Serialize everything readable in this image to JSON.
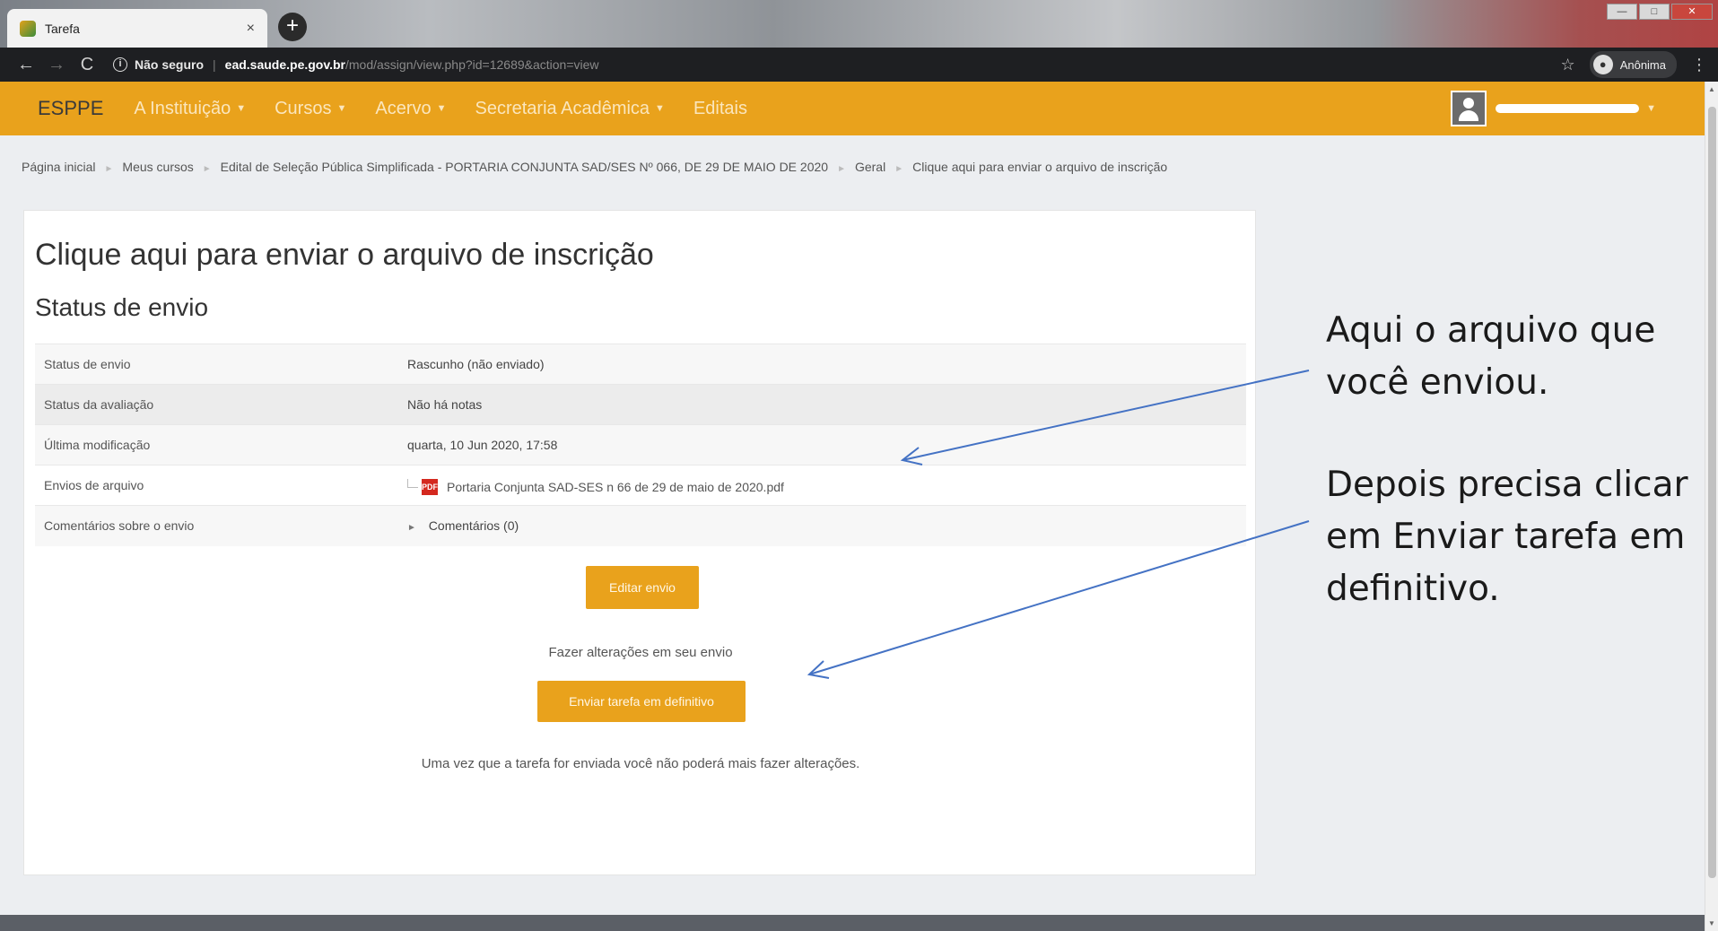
{
  "browser": {
    "tab_title": "Tarefa",
    "tab_close": "×",
    "new_tab": "+",
    "back": "←",
    "forward": "→",
    "reload": "C",
    "info": "i",
    "security": "Não seguro",
    "url_host": "ead.saude.pe.gov.br",
    "url_path": "/mod/assign/view.php?id=12689&action=view",
    "star": "☆",
    "profile_label": "Anônima",
    "menu": "⋮",
    "window_controls": [
      "—",
      "□",
      "✕"
    ]
  },
  "navbar": {
    "brand": "ESPPE",
    "items": [
      {
        "label": "A Instituição",
        "has_dropdown": true
      },
      {
        "label": "Cursos",
        "has_dropdown": true
      },
      {
        "label": "Acervo",
        "has_dropdown": true
      },
      {
        "label": "Secretaria Acadêmica",
        "has_dropdown": true
      },
      {
        "label": "Editais",
        "has_dropdown": false
      }
    ],
    "caret": "▼"
  },
  "breadcrumb": [
    "Página inicial",
    "Meus cursos",
    "Edital de Seleção Pública Simplificada - PORTARIA CONJUNTA SAD/SES Nº 066, DE 29 DE MAIO DE 2020",
    "Geral",
    "Clique aqui para enviar o arquivo de inscrição"
  ],
  "breadcrumb_sep": "►",
  "page": {
    "title": "Clique aqui para enviar o arquivo de inscrição",
    "section_title": "Status de envio",
    "rows": [
      {
        "label": "Status de envio",
        "value": "Rascunho (não enviado)"
      },
      {
        "label": "Status da avaliação",
        "value": "Não há notas"
      },
      {
        "label": "Última modificação",
        "value": "quarta, 10 Jun 2020, 17:58"
      },
      {
        "label": "Envios de arquivo",
        "value": "Portaria Conjunta SAD-SES n 66 de 29 de maio de 2020.pdf"
      },
      {
        "label": "Comentários sobre o envio",
        "value": "Comentários (0)"
      }
    ],
    "expand_caret": "►",
    "edit_button": "Editar envio",
    "edit_help": "Fazer alterações em seu envio",
    "submit_button": "Enviar tarefa em definitivo",
    "submit_help": "Uma vez que a tarefa for enviada você não poderá mais fazer alterações."
  },
  "annotations": {
    "note1": "Aqui o arquivo que você enviou.",
    "note2": "Depois precisa clicar em Enviar tarefa em definitivo.",
    "arrow_color": "#4472c4"
  },
  "colors": {
    "navbar": "#e9a21c",
    "button": "#e9a21c",
    "pdf": "#d4281f"
  }
}
